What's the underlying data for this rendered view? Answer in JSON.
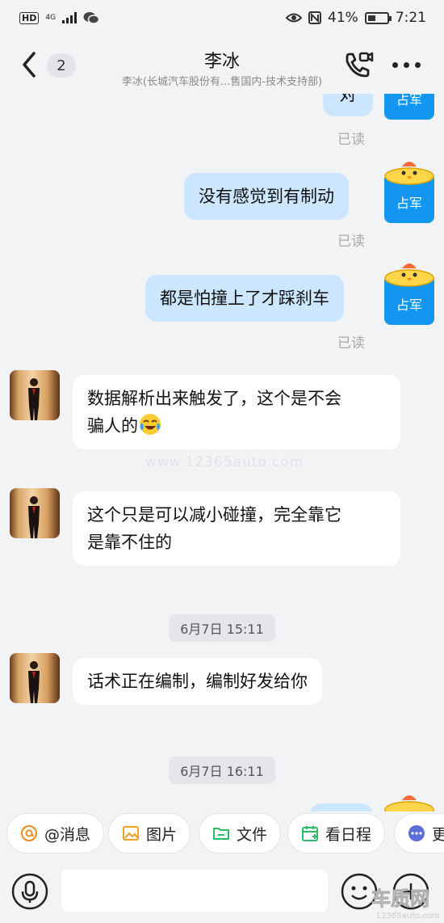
{
  "status_bar": {
    "hd": "HD",
    "network": "4G",
    "battery_percent": "41%",
    "battery_level": 0.41,
    "time": "7:21"
  },
  "header": {
    "unread_count": "2",
    "title": "李冰",
    "subtitle": "李冰(长城汽车股份有...售国内-技术支持部)"
  },
  "messages": [
    {
      "text": "对",
      "read": "已读"
    },
    {
      "text": "没有感觉到有制动",
      "read": "已读"
    },
    {
      "text": "都是怕撞上了才踩刹车",
      "read": "已读"
    },
    {
      "text_line1": "数据解析出来触发了，这个是不会",
      "text_line2": "骗人的"
    },
    {
      "text_line1": "这个只是可以减小碰撞，完全靠它",
      "text_line2": "是靠不住的"
    },
    {
      "time": "6月7日 15:11"
    },
    {
      "text": "话术正在编制，编制好发给你"
    },
    {
      "time": "6月7日 16:11"
    }
  ],
  "self_avatar_name": "占军",
  "watermark_text": "www.12365auto.com",
  "quick_actions": [
    {
      "label": "@消息",
      "icon": "at-icon"
    },
    {
      "label": "图片",
      "icon": "image-icon"
    },
    {
      "label": "文件",
      "icon": "folder-icon"
    },
    {
      "label": "看日程",
      "icon": "calendar-icon"
    },
    {
      "label": "更",
      "icon": "more-circle-icon"
    }
  ],
  "colors": {
    "accent": "#1296f0",
    "bubble_out": "#cce6ff",
    "bubble_in": "#ffffff",
    "background": "#f2f3f5"
  },
  "corner_logo_text": "车质网",
  "corner_logo_url": "12365auto.com"
}
